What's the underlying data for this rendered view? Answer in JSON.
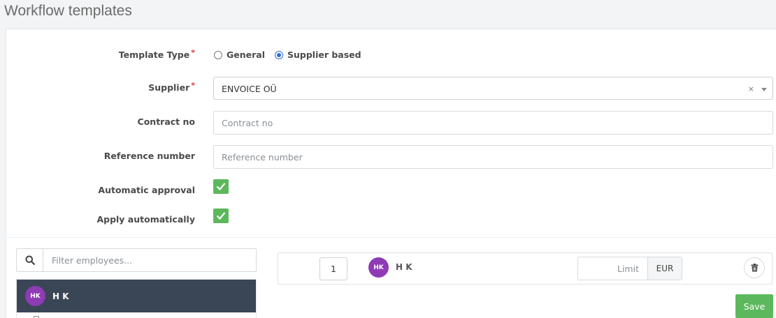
{
  "page": {
    "title": "Workflow templates"
  },
  "form": {
    "template_type": {
      "label": "Template Type",
      "required_mark": "*",
      "options": [
        {
          "label": "General",
          "selected": false
        },
        {
          "label": "Supplier based",
          "selected": true
        }
      ]
    },
    "supplier": {
      "label": "Supplier",
      "required_mark": "*",
      "value": "ENVOICE OÜ",
      "clear_glyph": "×"
    },
    "contract_no": {
      "label": "Contract no",
      "value": "",
      "placeholder": "Contract no"
    },
    "reference_number": {
      "label": "Reference number",
      "value": "",
      "placeholder": "Reference number"
    },
    "automatic_approval": {
      "label": "Automatic approval",
      "checked": true
    },
    "apply_automatically": {
      "label": "Apply automatically",
      "checked": true
    }
  },
  "employees": {
    "filter_placeholder": "Filter employees...",
    "items": [
      {
        "initials": "HK",
        "name": "H K",
        "selected": true
      }
    ]
  },
  "steps": [
    {
      "number": "1",
      "initials": "HK",
      "name": "H K",
      "limit_value": "",
      "limit_placeholder": "Limit",
      "currency": "EUR"
    }
  ],
  "actions": {
    "save_label": "Save"
  },
  "colors": {
    "accent_green": "#5cb85c",
    "selected_row_bg": "#3a4556",
    "avatar_bg": "#8e3bb5",
    "radio_blue": "#2b6fd6",
    "required_red": "#e03131"
  },
  "icons": {
    "search": "search-icon",
    "trash": "trash-icon",
    "check": "check-icon",
    "caret": "caret-down-icon"
  }
}
